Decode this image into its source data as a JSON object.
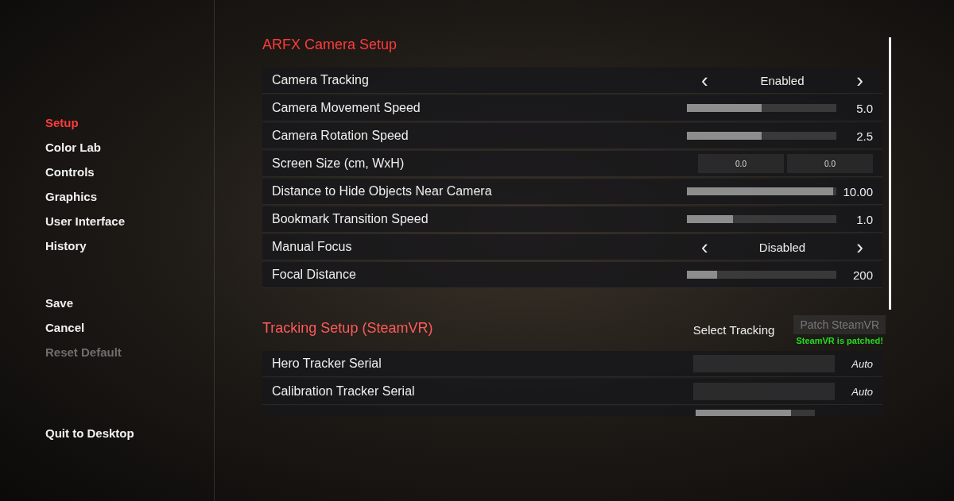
{
  "sidebar": {
    "items": [
      {
        "label": "Setup",
        "selected": true,
        "disabled": false
      },
      {
        "label": "Color Lab",
        "selected": false,
        "disabled": false
      },
      {
        "label": "Controls",
        "selected": false,
        "disabled": false
      },
      {
        "label": "Graphics",
        "selected": false,
        "disabled": false
      },
      {
        "label": "User Interface",
        "selected": false,
        "disabled": false
      },
      {
        "label": "History",
        "selected": false,
        "disabled": false
      }
    ],
    "actions": [
      {
        "label": "Save",
        "disabled": false
      },
      {
        "label": "Cancel",
        "disabled": false
      },
      {
        "label": "Reset Default",
        "disabled": true
      }
    ],
    "quit": "Quit to Desktop"
  },
  "sections": [
    {
      "title": "ARFX Camera Setup",
      "rows": [
        {
          "kind": "toggle",
          "label": "Camera Tracking",
          "value": "Enabled",
          "prev": "‹",
          "next": "›"
        },
        {
          "kind": "slider",
          "label": "Camera Movement Speed",
          "level": 0.5,
          "value": "5.0"
        },
        {
          "kind": "slider",
          "label": "Camera Rotation Speed",
          "level": 0.5,
          "value": "2.5"
        },
        {
          "kind": "pair",
          "label": "Screen Size (cm, WxH)",
          "values": [
            "0.0",
            "0.0"
          ]
        },
        {
          "kind": "slider",
          "label": "Distance to Hide Objects Near Camera",
          "level": 0.98,
          "value": "10.00"
        },
        {
          "kind": "slider",
          "label": "Bookmark Transition Speed",
          "level": 0.31,
          "value": "1.0"
        },
        {
          "kind": "toggle",
          "label": "Manual Focus",
          "value": "Disabled",
          "prev": "‹",
          "next": "›"
        },
        {
          "kind": "slider",
          "label": "Focal Distance",
          "level": 0.2,
          "value": "200"
        }
      ]
    },
    {
      "title": "Tracking Setup (SteamVR)",
      "select": "Select Tracking",
      "patch": {
        "label": "Patch SteamVR",
        "disabled": true,
        "status": "SteamVR is patched!"
      },
      "rows": [
        {
          "kind": "field",
          "label": "Hero Tracker Serial",
          "value": "Auto"
        },
        {
          "kind": "field",
          "label": "Calibration Tracker Serial",
          "value": "Auto"
        },
        {
          "kind": "clipped",
          "level": 0.8
        }
      ]
    }
  ]
}
